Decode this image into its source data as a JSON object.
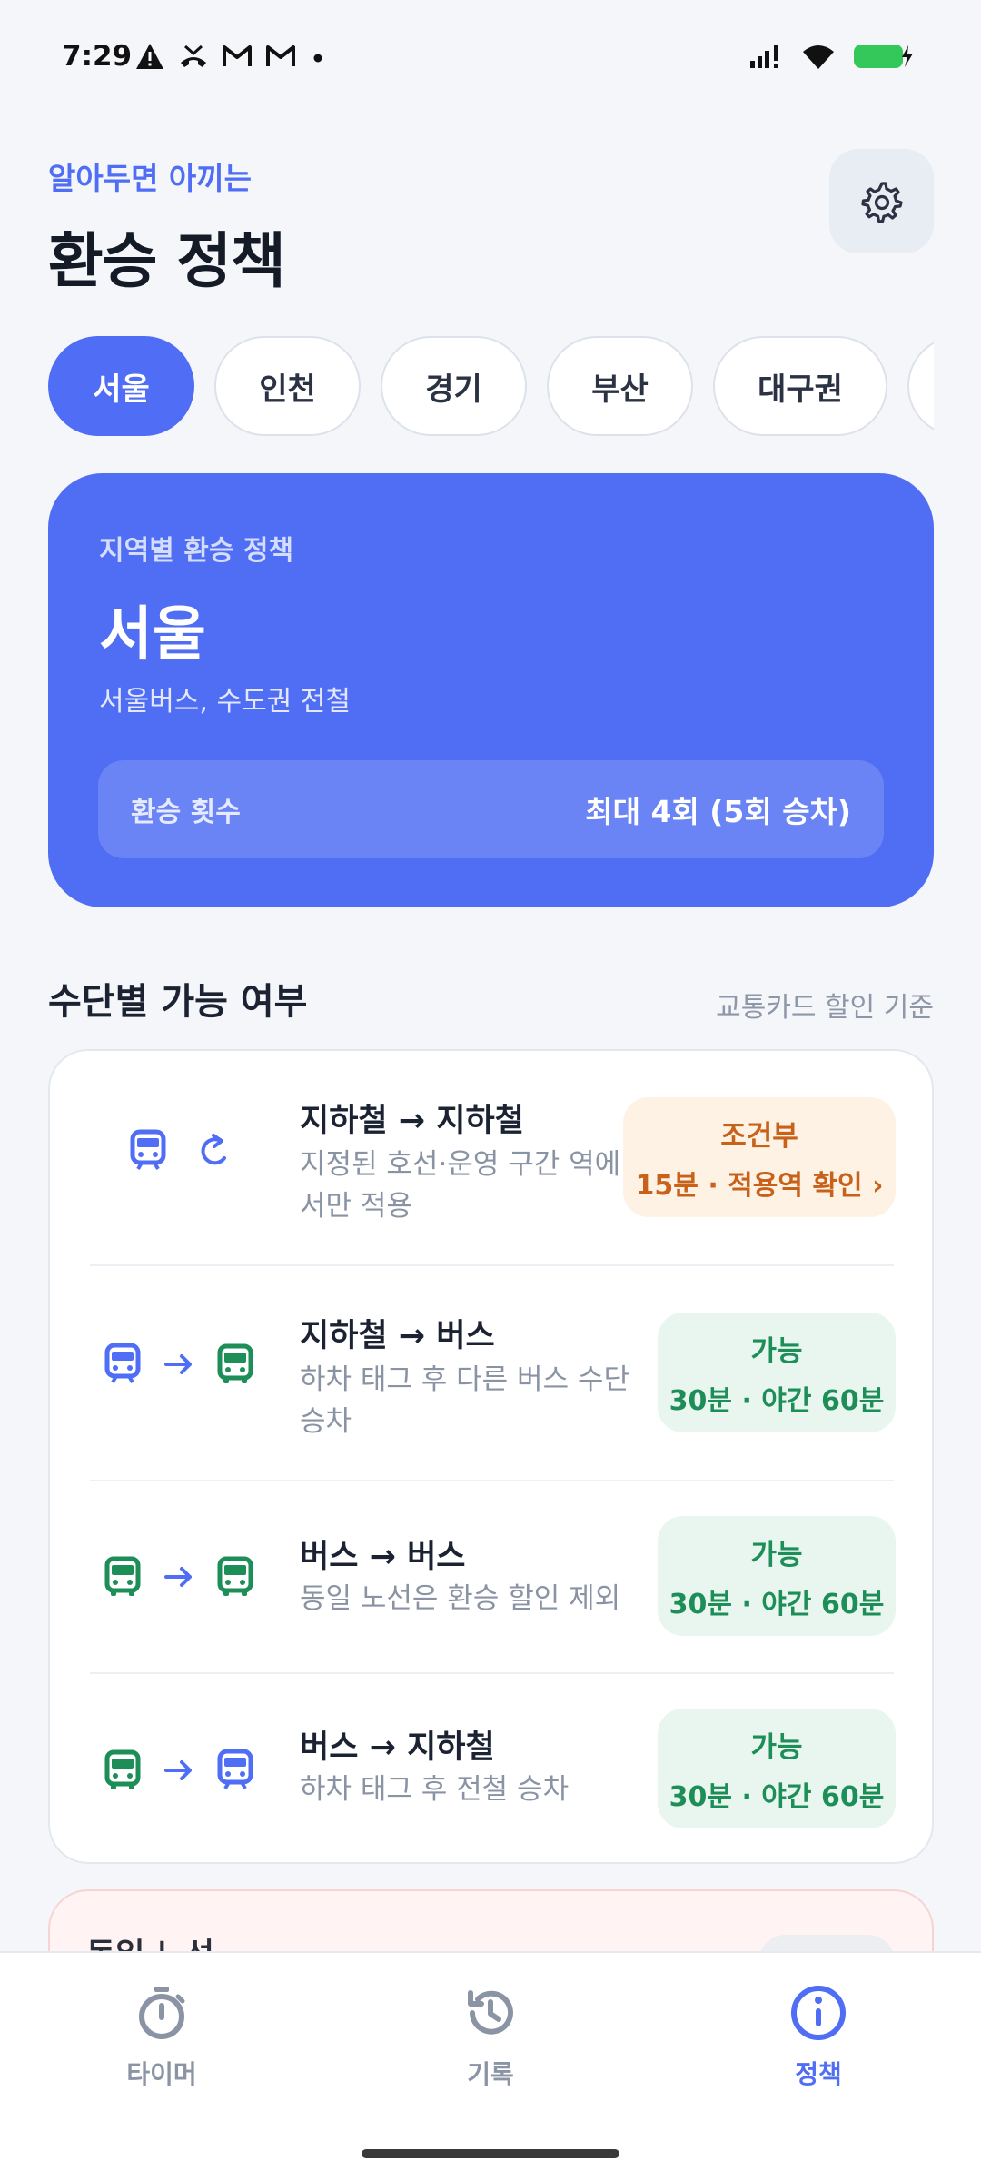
{
  "status_bar": {
    "time": "7:29",
    "left_icons": [
      "warning-icon",
      "missed-call-icon",
      "gmail-icon",
      "gmail-icon",
      "dot-icon"
    ],
    "right_icons": [
      "signal-icon",
      "wifi-icon",
      "battery-charging-icon"
    ]
  },
  "header": {
    "eyebrow": "알아두면 아끼는",
    "title": "환승 정책",
    "settings_icon": "gear-icon"
  },
  "regions": {
    "selected": "서울",
    "items": [
      "서울",
      "인천",
      "경기",
      "부산",
      "대구권"
    ]
  },
  "hero": {
    "label": "지역별 환승 정책",
    "title": "서울",
    "subtitle": "서울버스, 수도권 전철",
    "row_label": "환승 횟수",
    "row_value": "최대 4회 (5회 승차)",
    "color": "#506EF4"
  },
  "section": {
    "title": "수단별 가능 여부",
    "note": "교통카드 할인 기준"
  },
  "transfers": [
    {
      "from_icon": "subway-icon",
      "connector_icon": "refresh-icon",
      "to_icon": "",
      "title": "지하철 → 지하철",
      "desc": "지정된 호선·운영 구간 역에서만 적용",
      "status": "조건부",
      "detail": "15분 · 적용역 확인 ›",
      "kind": "cond"
    },
    {
      "from_icon": "subway-icon",
      "connector_icon": "arrow-right-icon",
      "to_icon": "bus-icon",
      "title": "지하철 → 버스",
      "desc": "하차 태그 후 다른 버스 수단 승차",
      "status": "가능",
      "detail": "30분 · 야간 60분",
      "kind": "ok"
    },
    {
      "from_icon": "bus-icon",
      "connector_icon": "arrow-right-icon",
      "to_icon": "bus-icon",
      "title": "버스 → 버스",
      "desc": "동일 노선은 환승 할인 제외",
      "status": "가능",
      "detail": "30분 · 야간 60분",
      "kind": "ok"
    },
    {
      "from_icon": "bus-icon",
      "connector_icon": "arrow-right-icon",
      "to_icon": "subway-icon",
      "title": "버스 → 지하철",
      "desc": "하차 태그 후 전철 승차",
      "status": "가능",
      "detail": "30분 · 야간 60분",
      "kind": "ok"
    }
  ],
  "peek": {
    "title": "동일 노선"
  },
  "nav": {
    "items": [
      {
        "label": "타이머",
        "icon": "stopwatch-icon"
      },
      {
        "label": "기록",
        "icon": "history-icon"
      },
      {
        "label": "정책",
        "icon": "info-icon"
      }
    ],
    "active": "정책",
    "active_color": "#4F6DF5"
  }
}
